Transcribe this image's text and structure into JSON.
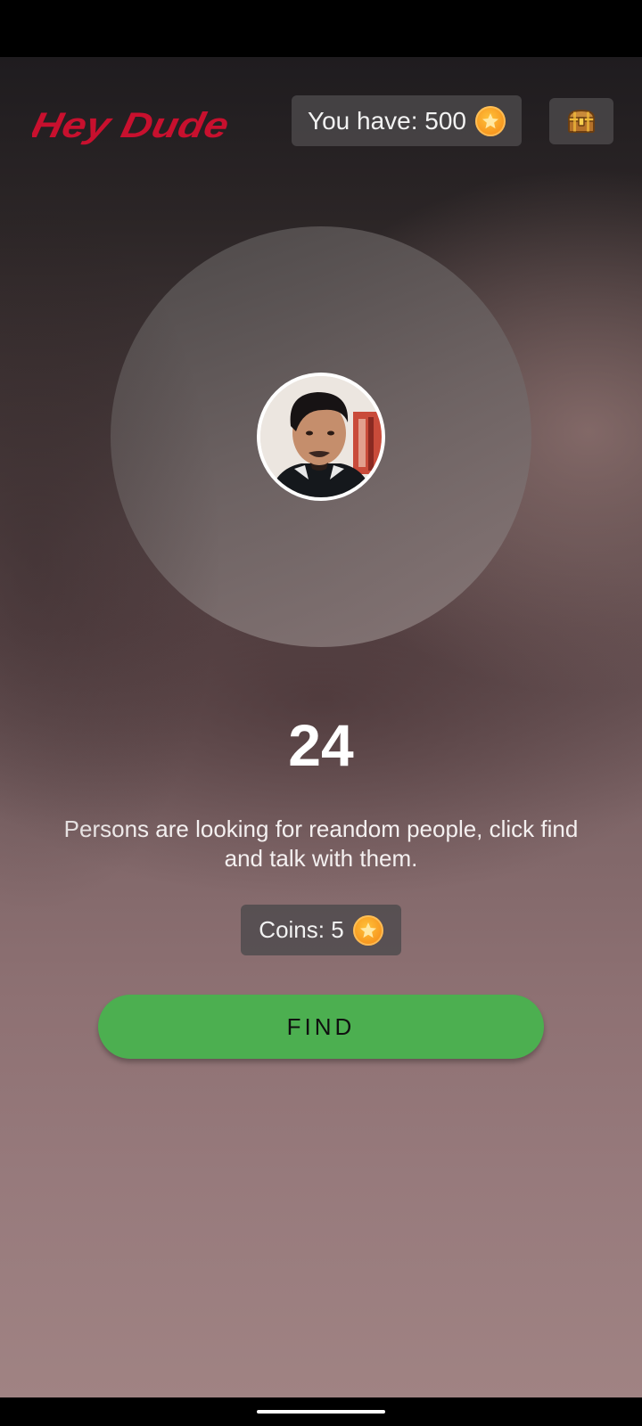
{
  "app": {
    "brand": "Hey Dude"
  },
  "header": {
    "balance_label": "You have: 500",
    "coin_icon": "star-coin-icon",
    "chest_icon": "treasure-chest-icon"
  },
  "finder": {
    "count": "24",
    "description": "Persons are looking for reandom people, click find and talk with them.",
    "cost_label": "Coins: 5",
    "find_label": "FIND"
  },
  "colors": {
    "brand_red": "#c8102e",
    "find_green": "#4caf50",
    "coin_orange": "#f7941d"
  }
}
